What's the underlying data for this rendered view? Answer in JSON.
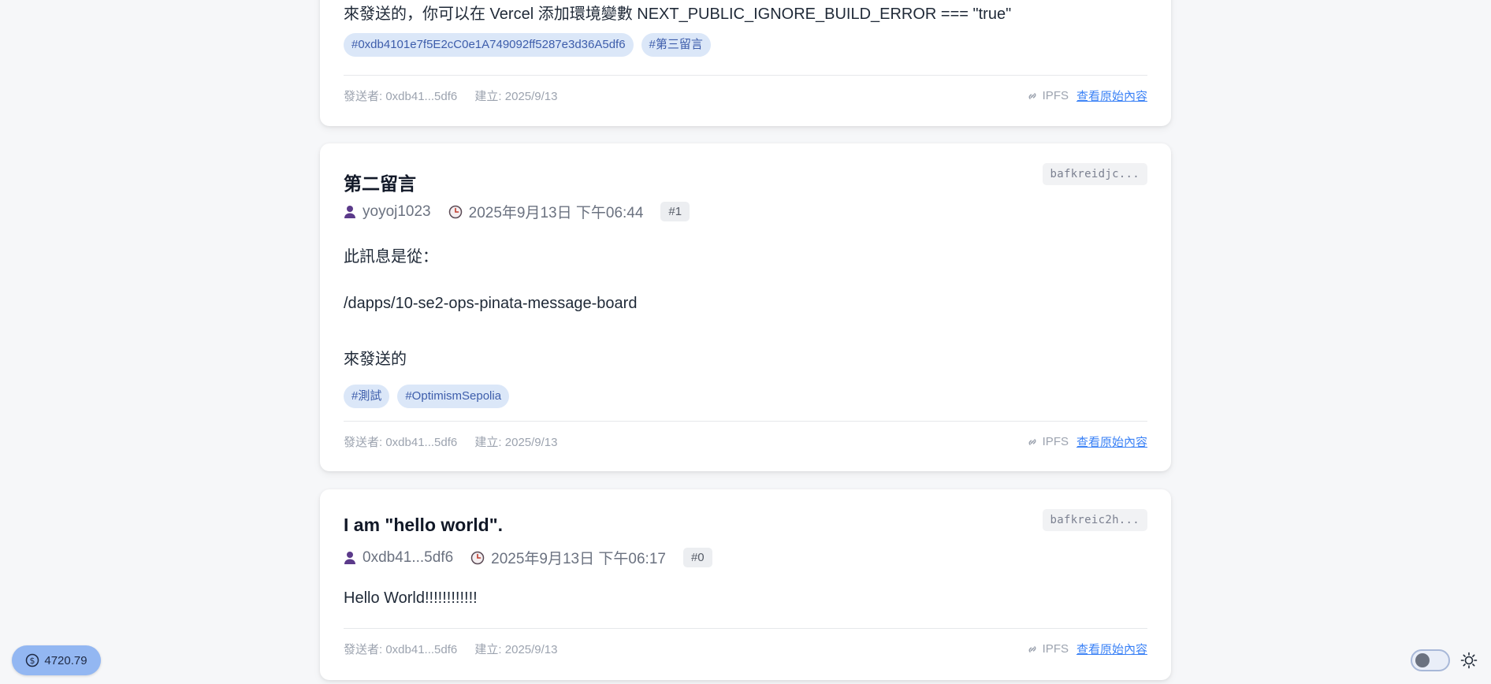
{
  "posts": [
    {
      "body_lines": [
        "來發送的，你可以在 Vercel 添加環境變數 NEXT_PUBLIC_IGNORE_BUILD_ERROR === \"true\""
      ],
      "tags": [
        "#0xdb4101e7f5E2cC0e1A749092ff5287e3d36A5df6",
        "#第三留言"
      ],
      "footer": {
        "sender": "發送者: 0xdb41...5df6",
        "created": "建立: 2025/9/13",
        "ipfs_label": "IPFS",
        "view_label": "查看原始內容"
      }
    },
    {
      "cid": "bafkreidjc...",
      "title": "第二留言",
      "author": "yoyoj1023",
      "timestamp": "2025年9月13日 下午06:44",
      "index": "#1",
      "body_lines": [
        "此訊息是從：",
        "/dapps/10-se2-ops-pinata-message-board",
        "來發送的"
      ],
      "tags": [
        "#測試",
        "#OptimismSepolia"
      ],
      "footer": {
        "sender": "發送者: 0xdb41...5df6",
        "created": "建立: 2025/9/13",
        "ipfs_label": "IPFS",
        "view_label": "查看原始內容"
      }
    },
    {
      "cid": "bafkreic2h...",
      "title": "I am \"hello world\".",
      "author": "0xdb41...5df6",
      "timestamp": "2025年9月13日 下午06:17",
      "index": "#0",
      "body_lines": [
        "Hello World!!!!!!!!!!!!"
      ],
      "footer": {
        "sender": "發送者: 0xdb41...5df6",
        "created": "建立: 2025/9/13",
        "ipfs_label": "IPFS",
        "view_label": "查看原始內容"
      }
    }
  ],
  "balance": {
    "value": "4720.79",
    "icon": "dollar-circle-icon"
  },
  "theme": {
    "toggle_icon": "toggle-icon",
    "sun_icon": "sun-icon"
  },
  "colors": {
    "tag_bg": "#dbe7f8",
    "tag_text": "#3d5dab",
    "link": "#3b82f6",
    "balance_bg": "#93b7f2"
  }
}
